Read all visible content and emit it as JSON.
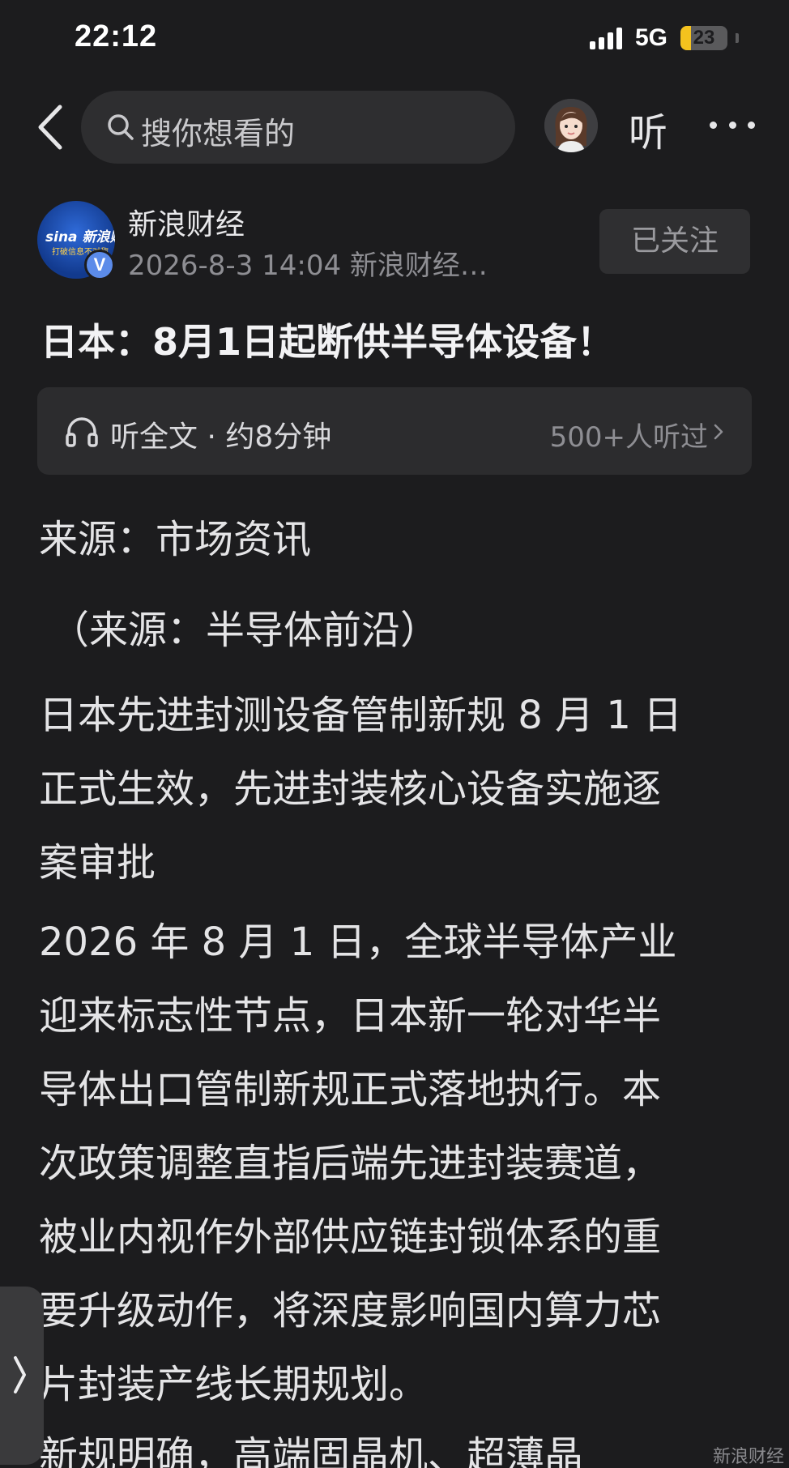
{
  "status_bar": {
    "time": "22:12",
    "network": "5G",
    "battery_level": "23",
    "battery_fraction": 0.23
  },
  "nav": {
    "search_placeholder": "搜你想看的",
    "listen_label": "听",
    "icons": [
      "chevron-left-icon",
      "search-icon",
      "avatar",
      "more-icon"
    ]
  },
  "author": {
    "logo_text": "sina 新浪财经",
    "logo_subtext": "打破信息不对称",
    "name": "新浪财经",
    "meta": "2026-8-3 14:04 新浪财经…",
    "verified_mark": "V",
    "follow_label": "已关注"
  },
  "article": {
    "headline": "日本：8月1日起断供半导体设备！",
    "listen_bar": {
      "label": "听全文 · 约8分钟",
      "count": "500+人听过"
    },
    "source": "来源：市场资讯",
    "source2": "（来源：半导体前沿）",
    "para1_lines": [
      "日本先进封测设备管制新规 8 月 1 日",
      "正式生效，先进封装核心设备实施逐",
      "案审批"
    ],
    "para2_lines": [
      "2026 年 8 月 1 日，全球半导体产业",
      "迎来标志性节点，日本新一轮对华半",
      "导体出口管制新规正式落地执行。本",
      "次政策调整直指后端先进封装赛道，",
      "被业内视作外部供应链封锁体系的重",
      "要升级动作，将深度影响国内算力芯",
      "片封装产线长期规划。"
    ],
    "para3_partial": "新规明确，高端固晶机、超薄晶"
  },
  "watermark": "新浪财经"
}
